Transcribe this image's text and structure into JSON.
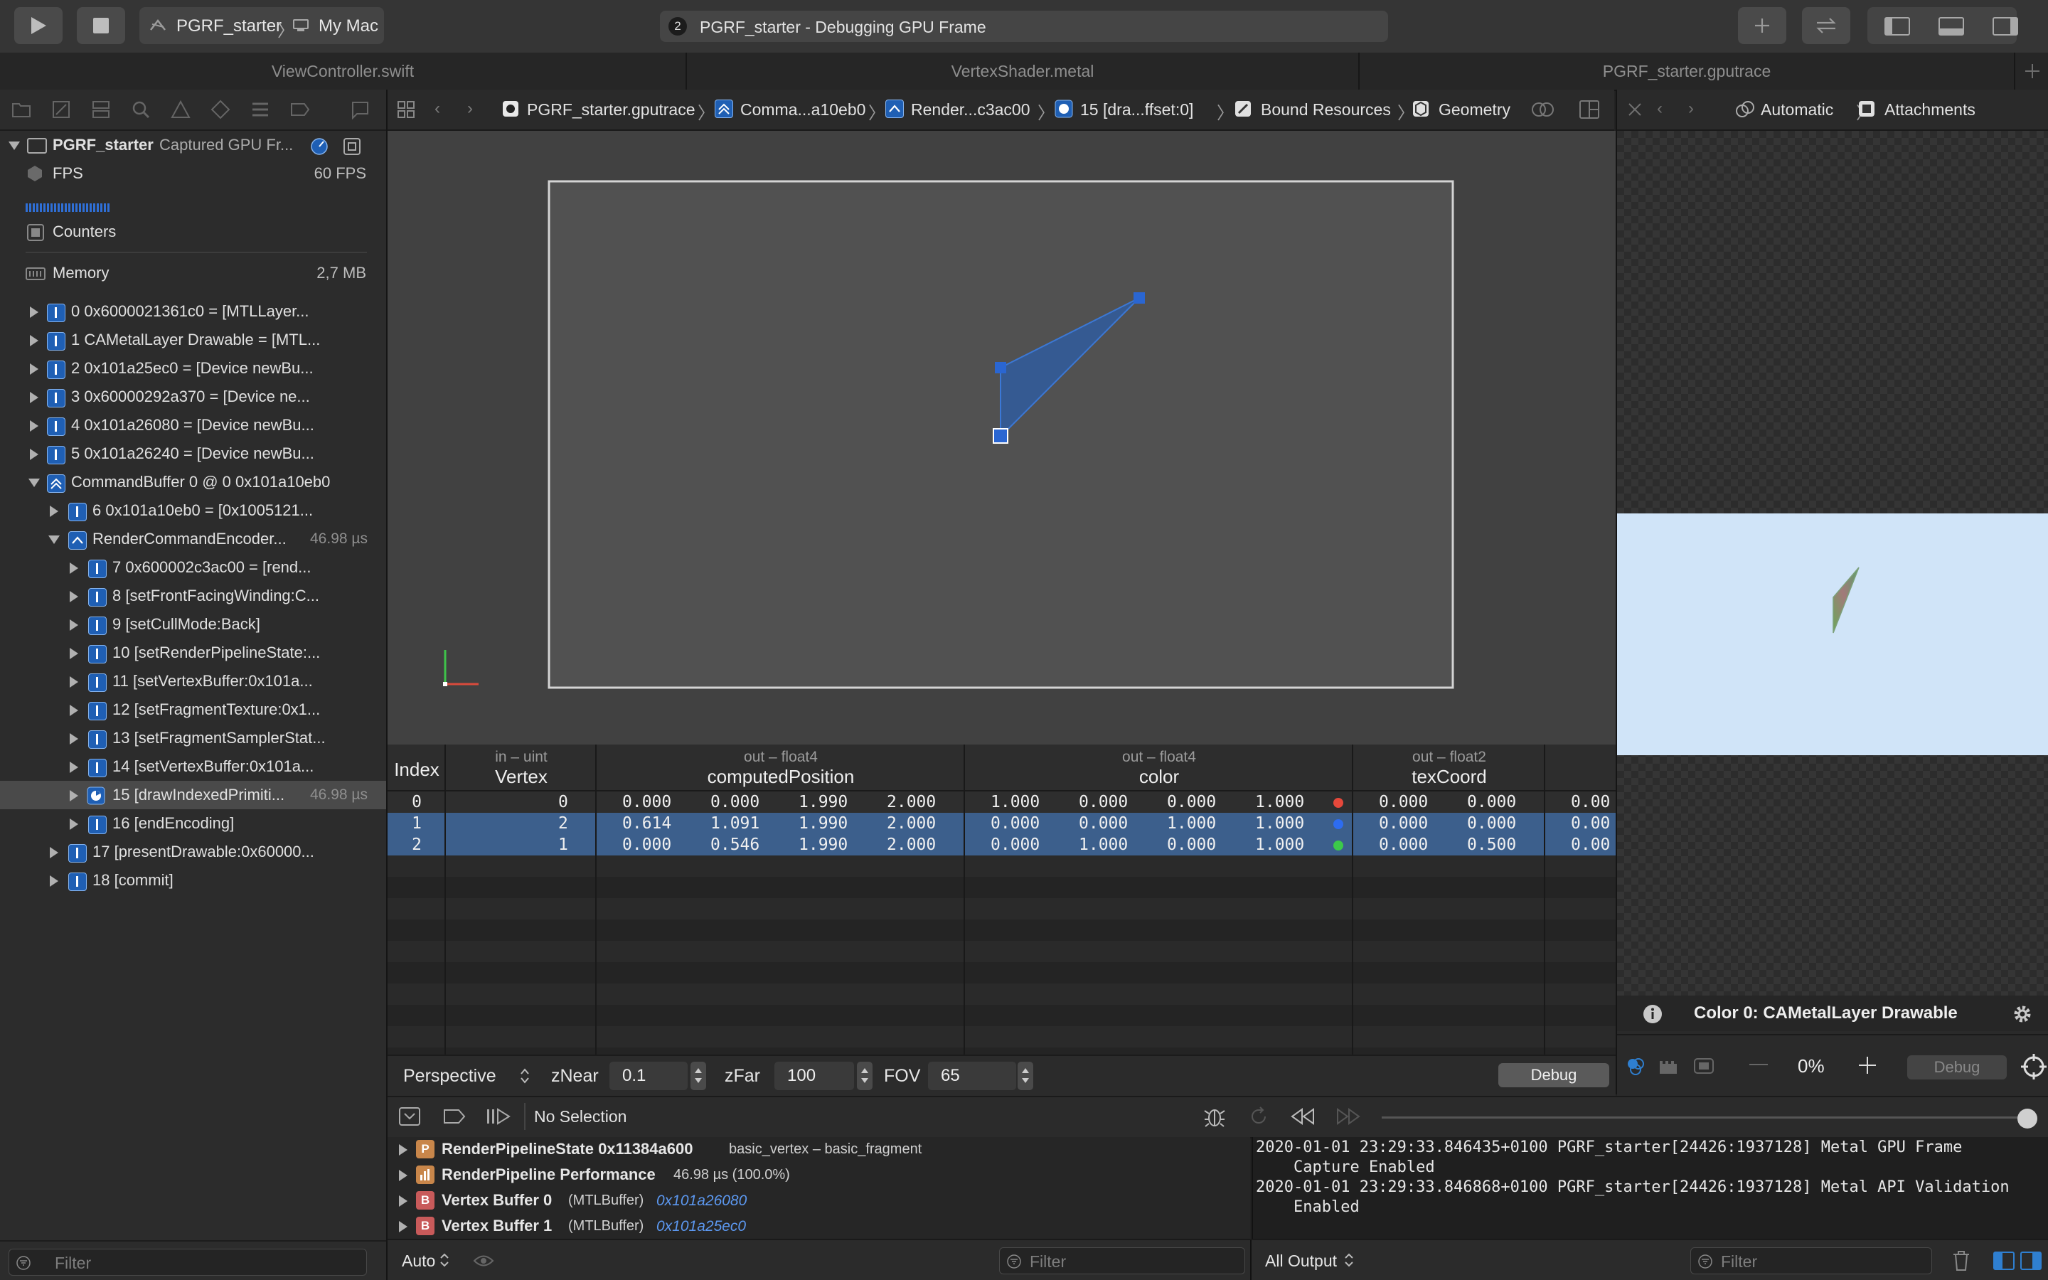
{
  "toolbar": {
    "scheme_project": "PGRF_starter",
    "scheme_destination": "My Mac",
    "activity_badge": "2",
    "activity_text": "PGRF_starter - Debugging GPU Frame"
  },
  "tabs": [
    "ViewController.swift",
    "VertexShader.metal",
    "PGRF_starter.gputrace"
  ],
  "navigator": {
    "root_name": "PGRF_starter",
    "root_desc": "Captured GPU Fr...",
    "fps_label": "FPS",
    "fps_value": "60 FPS",
    "counters_label": "Counters",
    "memory_label": "Memory",
    "memory_value": "2,7 MB",
    "items": [
      {
        "label": "0 0x6000021361c0 = [MTLLayer..."
      },
      {
        "label": "1 CAMetalLayer Drawable = [MTL..."
      },
      {
        "label": "2 0x101a25ec0 = [Device newBu..."
      },
      {
        "label": "3 0x60000292a370 = [Device ne..."
      },
      {
        "label": "4 0x101a26080 = [Device newBu..."
      },
      {
        "label": "5 0x101a26240 = [Device newBu..."
      },
      {
        "label": "CommandBuffer 0 @ 0 0x101a10eb0"
      },
      {
        "label": "6 0x101a10eb0 = [0x1005121..."
      },
      {
        "label": "RenderCommandEncoder...",
        "time": "46.98 µs"
      },
      {
        "label": "7 0x600002c3ac00 = [rend..."
      },
      {
        "label": "8 [setFrontFacingWinding:C..."
      },
      {
        "label": "9 [setCullMode:Back]"
      },
      {
        "label": "10 [setRenderPipelineState:..."
      },
      {
        "label": "11 [setVertexBuffer:0x101a..."
      },
      {
        "label": "12 [setFragmentTexture:0x1..."
      },
      {
        "label": "13 [setFragmentSamplerStat..."
      },
      {
        "label": "14 [setVertexBuffer:0x101a..."
      },
      {
        "label": "15 [drawIndexedPrimiti...",
        "time": "46.98 µs"
      },
      {
        "label": "16 [endEncoding]"
      },
      {
        "label": "17 [presentDrawable:0x60000..."
      },
      {
        "label": "18 [commit]"
      }
    ],
    "filter_placeholder": "Filter"
  },
  "jumpbar": {
    "crumbs": [
      "PGRF_starter.gputrace",
      "Comma...a10eb0",
      "Render...c3ac00",
      "15 [dra...ffset:0]",
      "Bound Resources",
      "Geometry"
    ]
  },
  "buffer_table": {
    "index_header": "Index",
    "columns": [
      {
        "sub": "in – uint",
        "name": "Vertex"
      },
      {
        "sub": "out – float4",
        "name": "computedPosition"
      },
      {
        "sub": "out – float4",
        "name": "color"
      },
      {
        "sub": "out – float2",
        "name": "texCoord"
      }
    ],
    "rows": [
      {
        "index": "0",
        "vertex": "0",
        "pos": [
          "0.000",
          "0.000",
          "1.990",
          "2.000"
        ],
        "color": [
          "1.000",
          "0.000",
          "0.000",
          "1.000"
        ],
        "dot": "#e5483b",
        "tex": [
          "0.000",
          "0.000"
        ],
        "extra": "0.00"
      },
      {
        "index": "1",
        "vertex": "2",
        "pos": [
          "0.614",
          "1.091",
          "1.990",
          "2.000"
        ],
        "color": [
          "0.000",
          "0.000",
          "1.000",
          "1.000"
        ],
        "dot": "#2d6cf0",
        "tex": [
          "0.000",
          "0.000"
        ],
        "extra": "0.00"
      },
      {
        "index": "2",
        "vertex": "1",
        "pos": [
          "0.000",
          "0.546",
          "1.990",
          "2.000"
        ],
        "color": [
          "0.000",
          "1.000",
          "0.000",
          "1.000"
        ],
        "dot": "#3cc94a",
        "tex": [
          "0.000",
          "0.500"
        ],
        "extra": "0.00"
      }
    ]
  },
  "view_controls": {
    "projection": "Perspective",
    "znear_label": "zNear",
    "znear_value": "0.1",
    "zfar_label": "zFar",
    "zfar_value": "100",
    "fov_label": "FOV",
    "fov_value": "65",
    "debug_button": "Debug"
  },
  "right_pane": {
    "automatic": "Automatic",
    "attachments": "Attachments",
    "attachment_title": "Color 0: CAMetalLayer Drawable",
    "zoom_value": "0%",
    "debug_button": "Debug"
  },
  "debug_bar": {
    "selection": "No Selection"
  },
  "variables": [
    {
      "badge": "P",
      "badge_color": "#c8864a",
      "name": "RenderPipelineState 0x11384a600",
      "detail": "basic_vertex – basic_fragment",
      "link": ""
    },
    {
      "badge": "",
      "badge_color": "#c8864a",
      "name": "RenderPipeline Performance",
      "detail": "46.98 µs (100.0%)",
      "link": ""
    },
    {
      "badge": "B",
      "badge_color": "#c85a5a",
      "name": "Vertex Buffer 0",
      "detail": "(MTLBuffer)",
      "link": "0x101a26080"
    },
    {
      "badge": "B",
      "badge_color": "#c85a5a",
      "name": "Vertex Buffer 1",
      "detail": "(MTLBuffer)",
      "link": "0x101a25ec0"
    }
  ],
  "console": {
    "lines": [
      "2020-01-01 23:29:33.846435+0100 PGRF_starter[24426:1937128] Metal GPU Frame",
      "    Capture Enabled",
      "2020-01-01 23:29:33.846868+0100 PGRF_starter[24426:1937128] Metal API Validation",
      "    Enabled"
    ]
  },
  "bottom": {
    "auto_label": "Auto",
    "filter_placeholder": "Filter",
    "output_select": "All Output",
    "console_filter_placeholder": "Filter"
  }
}
